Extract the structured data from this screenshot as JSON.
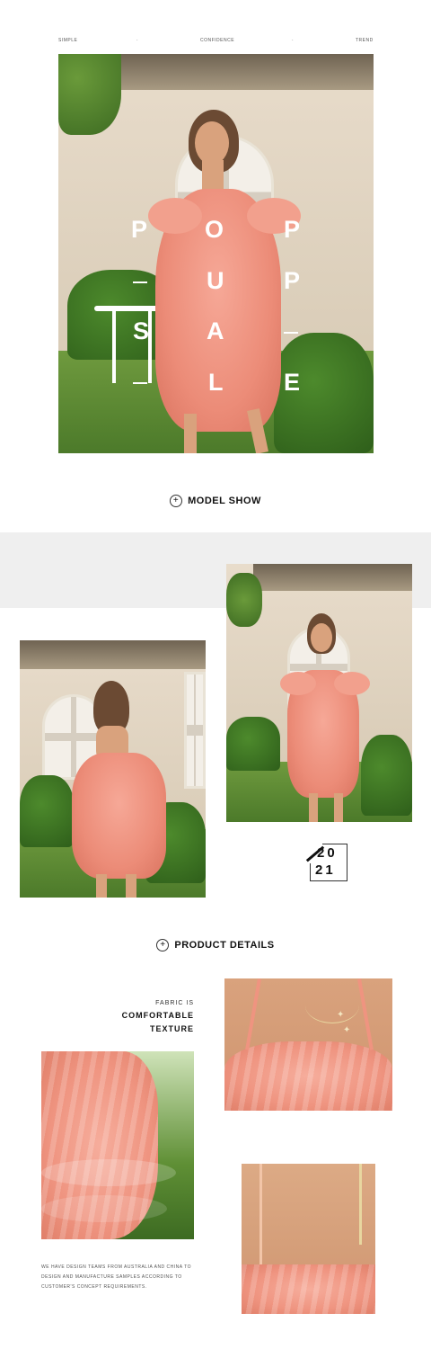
{
  "tagline": {
    "left": "SIMPLE",
    "dot1": "·",
    "middle": "CONFIDENCE",
    "dot2": "·",
    "right": "TREND"
  },
  "hero": {
    "letters_col1": [
      "P",
      "—",
      "S",
      "—"
    ],
    "letters_col2": [
      "O",
      "U",
      "A",
      "L"
    ],
    "letters_col3": [
      "P",
      "P",
      "—",
      "E"
    ]
  },
  "model_show": {
    "icon": "plus-circle-icon",
    "label": "MODEL SHOW"
  },
  "year": {
    "line1": "20",
    "line2": "21"
  },
  "product_details": {
    "icon": "plus-circle-icon",
    "label": "PRODUCT DETAILS"
  },
  "fabric": {
    "line1": "FABRIC IS",
    "line2": "COMFORTABLE",
    "line3": "TEXTURE"
  },
  "description": "WE HAVE DESIGN TEAMS FROM AUSTRALIA AND CHINA TO DESIGN AND MANUFACTURE SAMPLES ACCORDING TO CUSTOMER'S CONCEPT REQUIREMENTS.",
  "colors": {
    "dress": "#ec8c78",
    "band": "#efefef"
  }
}
